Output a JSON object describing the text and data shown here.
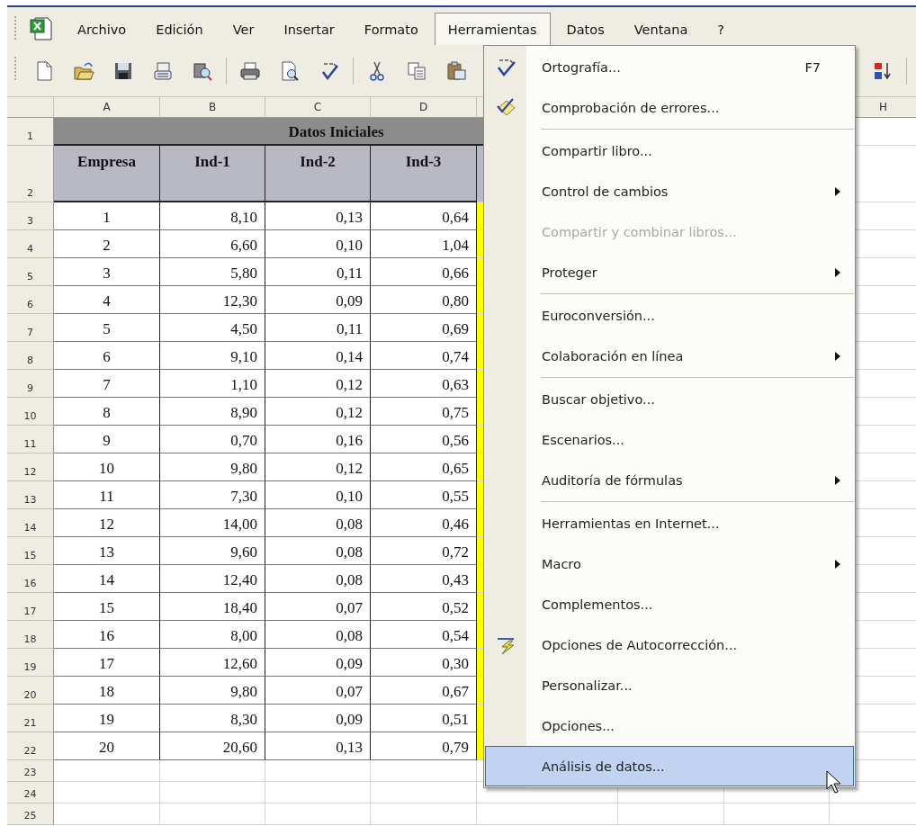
{
  "menu_bar": {
    "items": [
      {
        "label": "Archivo",
        "selected": false
      },
      {
        "label": "Edición",
        "selected": false
      },
      {
        "label": "Ver",
        "selected": false
      },
      {
        "label": "Insertar",
        "selected": false
      },
      {
        "label": "Formato",
        "selected": false
      },
      {
        "label": "Herramientas",
        "selected": true
      },
      {
        "label": "Datos",
        "selected": false
      },
      {
        "label": "Ventana",
        "selected": false
      },
      {
        "label": "?",
        "selected": false
      }
    ]
  },
  "sheet": {
    "column_headers": [
      "A",
      "B",
      "C",
      "D",
      "H"
    ],
    "row_numbers": [
      "1",
      "2",
      "3",
      "4",
      "5",
      "6",
      "7",
      "8",
      "9",
      "10",
      "11",
      "12",
      "13",
      "14",
      "15",
      "16",
      "17",
      "18",
      "19",
      "20",
      "21",
      "22",
      "23",
      "24",
      "25"
    ],
    "title": "Datos Iniciales",
    "header": [
      "Empresa",
      "Ind-1",
      "Ind-2",
      "Ind-3"
    ],
    "rows": [
      [
        "1",
        "8,10",
        "0,13",
        "0,64"
      ],
      [
        "2",
        "6,60",
        "0,10",
        "1,04"
      ],
      [
        "3",
        "5,80",
        "0,11",
        "0,66"
      ],
      [
        "4",
        "12,30",
        "0,09",
        "0,80"
      ],
      [
        "5",
        "4,50",
        "0,11",
        "0,69"
      ],
      [
        "6",
        "9,10",
        "0,14",
        "0,74"
      ],
      [
        "7",
        "1,10",
        "0,12",
        "0,63"
      ],
      [
        "8",
        "8,90",
        "0,12",
        "0,75"
      ],
      [
        "9",
        "0,70",
        "0,16",
        "0,56"
      ],
      [
        "10",
        "9,80",
        "0,12",
        "0,65"
      ],
      [
        "11",
        "7,30",
        "0,10",
        "0,55"
      ],
      [
        "12",
        "14,00",
        "0,08",
        "0,46"
      ],
      [
        "13",
        "9,60",
        "0,08",
        "0,72"
      ],
      [
        "14",
        "12,40",
        "0,08",
        "0,43"
      ],
      [
        "15",
        "18,40",
        "0,07",
        "0,52"
      ],
      [
        "16",
        "8,00",
        "0,08",
        "0,54"
      ],
      [
        "17",
        "12,60",
        "0,09",
        "0,30"
      ],
      [
        "18",
        "9,80",
        "0,07",
        "0,67"
      ],
      [
        "19",
        "8,30",
        "0,09",
        "0,51"
      ],
      [
        "20",
        "20,60",
        "0,13",
        "0,79"
      ]
    ]
  },
  "tools_menu": {
    "items": [
      {
        "label": "Ortografía...",
        "shortcut": "F7",
        "kind": "spelling",
        "submenu": false,
        "disabled": false,
        "selected": false
      },
      {
        "label": "Comprobación de errores...",
        "kind": "error_check",
        "submenu": false,
        "disabled": false,
        "selected": false
      },
      {
        "kind": "separator"
      },
      {
        "label": "Compartir libro...",
        "kind": "plain",
        "submenu": false,
        "disabled": false,
        "selected": false
      },
      {
        "label": "Control de cambios",
        "kind": "plain",
        "submenu": true,
        "disabled": false,
        "selected": false
      },
      {
        "label": "Compartir y combinar libros...",
        "kind": "plain",
        "submenu": false,
        "disabled": true,
        "selected": false
      },
      {
        "label": "Proteger",
        "kind": "plain",
        "submenu": true,
        "disabled": false,
        "selected": false
      },
      {
        "kind": "separator"
      },
      {
        "label": "Euroconversión...",
        "kind": "plain",
        "submenu": false,
        "disabled": false,
        "selected": false
      },
      {
        "label": "Colaboración en línea",
        "kind": "plain",
        "submenu": true,
        "disabled": false,
        "selected": false
      },
      {
        "kind": "separator"
      },
      {
        "label": "Buscar objetivo...",
        "kind": "plain",
        "submenu": false,
        "disabled": false,
        "selected": false
      },
      {
        "label": "Escenarios...",
        "kind": "plain",
        "submenu": false,
        "disabled": false,
        "selected": false
      },
      {
        "label": "Auditoría de fórmulas",
        "kind": "plain",
        "submenu": true,
        "disabled": false,
        "selected": false
      },
      {
        "kind": "separator"
      },
      {
        "label": "Herramientas en Internet...",
        "kind": "plain",
        "submenu": false,
        "disabled": false,
        "selected": false
      },
      {
        "label": "Macro",
        "kind": "plain",
        "submenu": true,
        "disabled": false,
        "selected": false
      },
      {
        "label": "Complementos...",
        "kind": "plain",
        "submenu": false,
        "disabled": false,
        "selected": false
      },
      {
        "label": "Opciones de Autocorrección...",
        "kind": "autocorrect",
        "submenu": false,
        "disabled": false,
        "selected": false
      },
      {
        "label": "Personalizar...",
        "kind": "plain",
        "submenu": false,
        "disabled": false,
        "selected": false
      },
      {
        "label": "Opciones...",
        "kind": "plain",
        "submenu": false,
        "disabled": false,
        "selected": false
      },
      {
        "label": "Análisis de datos...",
        "kind": "plain",
        "submenu": false,
        "disabled": false,
        "selected": true
      }
    ]
  }
}
